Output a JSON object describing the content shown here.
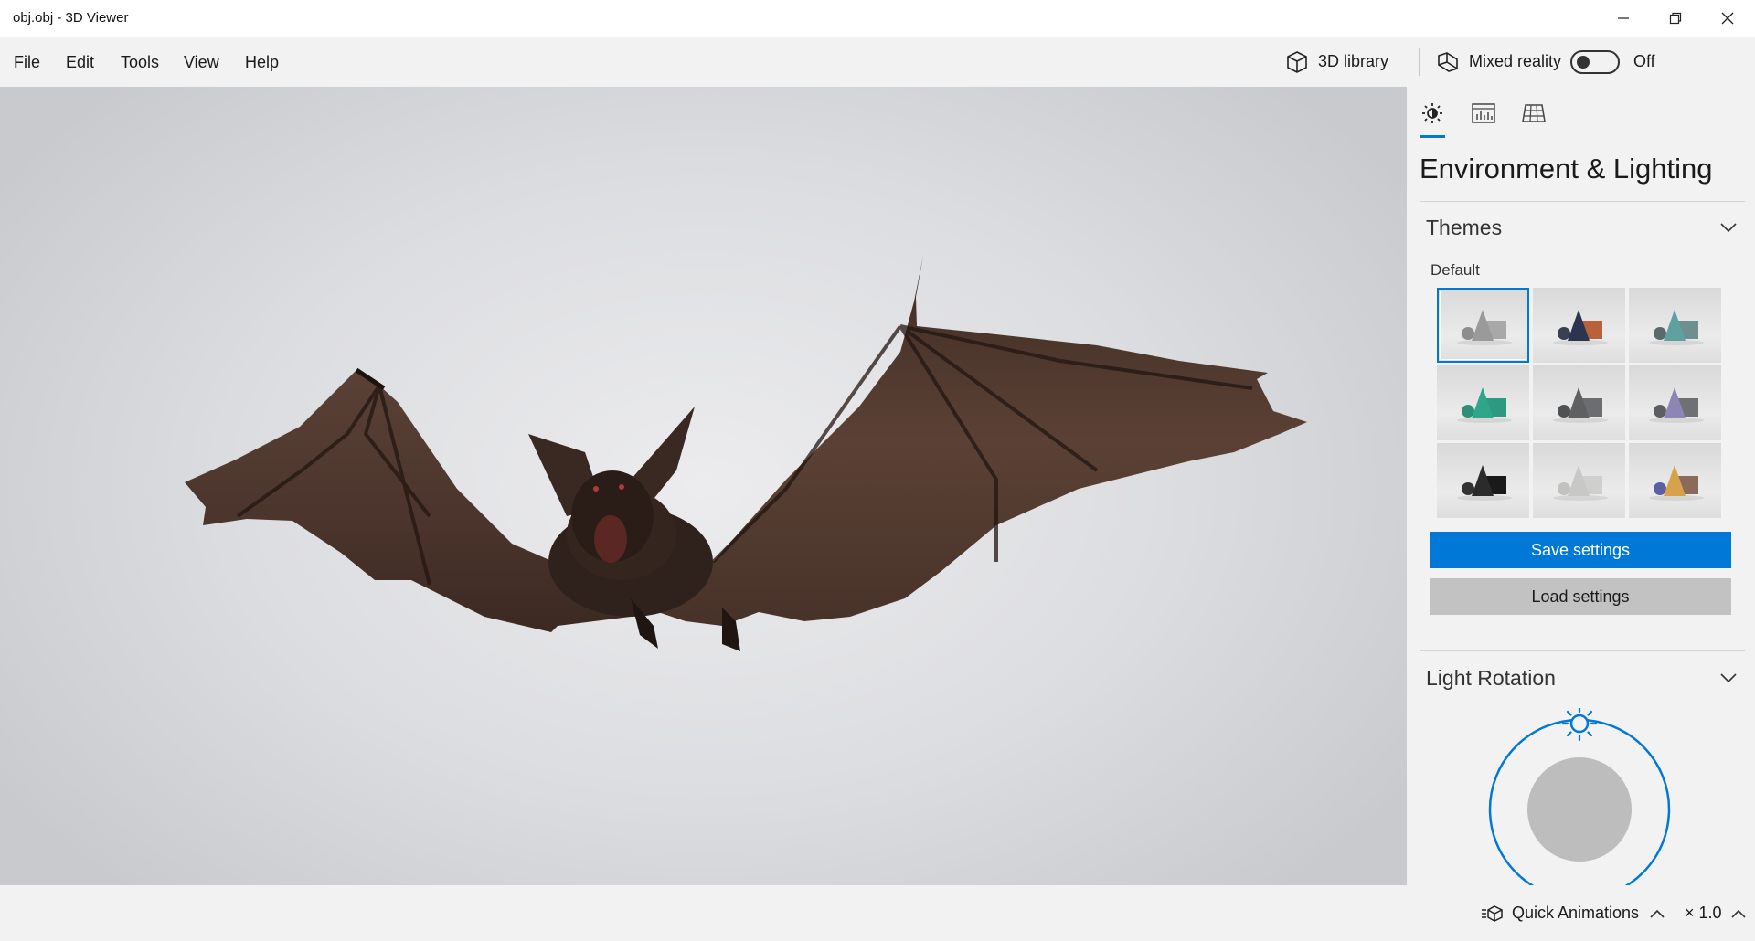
{
  "window": {
    "title": "obj.obj - 3D Viewer",
    "minimize_icon": "minimize-icon",
    "restore_icon": "restore-icon",
    "close_icon": "close-icon"
  },
  "menu": {
    "items": [
      "File",
      "Edit",
      "Tools",
      "View",
      "Help"
    ]
  },
  "toolbar": {
    "library_label": "3D library",
    "library_icon": "cube-icon",
    "mixed_reality_label": "Mixed reality",
    "mixed_reality_icon": "mixed-reality-icon",
    "mixed_reality_state": "Off"
  },
  "viewport": {
    "model": "bat-model"
  },
  "panel": {
    "tabs": [
      {
        "icon": "environment-lighting-icon",
        "active": true
      },
      {
        "icon": "stats-shading-icon",
        "active": false
      },
      {
        "icon": "grid-views-icon",
        "active": false
      }
    ],
    "title": "Environment & Lighting",
    "themes": {
      "heading": "Themes",
      "selected_label": "Default",
      "tiles": [
        {
          "cone": "#9a9a9a",
          "box": "#a8a8a8",
          "ball": "#8e8e8e",
          "selected": true
        },
        {
          "cone": "#2b3550",
          "box": "#b8613a",
          "ball": "#3a3f56"
        },
        {
          "cone": "#5fa0a0",
          "box": "#6d8f8f",
          "ball": "#5a6a6a"
        },
        {
          "cone": "#2fa58a",
          "box": "#2b9a80",
          "ball": "#2d8f78"
        },
        {
          "cone": "#5e6062",
          "box": "#6b6d70",
          "ball": "#4f5153"
        },
        {
          "cone": "#8d86b5",
          "box": "#6f7074",
          "ball": "#5d5e62"
        },
        {
          "cone": "#2b2b2b",
          "box": "#1a1a1a",
          "ball": "#333333"
        },
        {
          "cone": "#c8c8c6",
          "box": "#cfcfcd",
          "ball": "#c2c2c0"
        },
        {
          "cone": "#d8a24c",
          "box": "#8a6a58",
          "ball": "#5c5fa0"
        }
      ],
      "save_button": "Save settings",
      "load_button": "Load settings"
    },
    "light_rotation": {
      "heading": "Light Rotation",
      "sun_icon": "sun-icon"
    }
  },
  "statusbar": {
    "quick_animations": "Quick Animations",
    "speed": "× 1.0"
  },
  "colors": {
    "accent": "#0078d7",
    "panel_bg": "#f2f2f2"
  }
}
